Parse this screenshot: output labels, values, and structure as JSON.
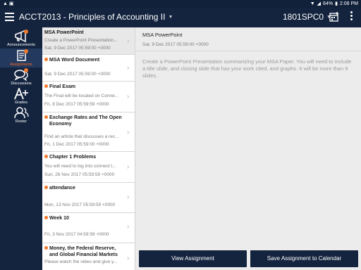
{
  "status_bar": {
    "left_icons": [
      "notification-icon",
      "image-icon"
    ],
    "battery": "64%",
    "time": "2:08 PM"
  },
  "app_bar": {
    "course_title": "ACCT2013 - Principles of Accounting II",
    "section": "1801SPC0"
  },
  "left_nav": {
    "items": [
      {
        "label": "Announcements",
        "icon": "megaphone-icon",
        "active": false,
        "badge": true
      },
      {
        "label": "Assignments",
        "icon": "assignments-icon",
        "active": true,
        "badge": true
      },
      {
        "label": "Discussions",
        "icon": "discussions-icon",
        "active": false,
        "badge": true
      },
      {
        "label": "Grades",
        "icon": "grades-icon",
        "active": false,
        "badge": false
      },
      {
        "label": "Roster",
        "icon": "roster-icon",
        "active": false,
        "badge": false
      }
    ]
  },
  "assignment_list": [
    {
      "title": "MSA PowerPoint",
      "preview": "Create a PowerPoint Presentation...",
      "date": "Sat, 9 Dec 2017 05:59:00 +0000",
      "unread": false,
      "selected": true
    },
    {
      "title": "MSA Word Document",
      "preview": "",
      "date": "Sat, 9 Dec 2017 05:59:00 +0000",
      "unread": true,
      "selected": false
    },
    {
      "title": "Final Exam",
      "preview": "The Final will be located on Conne...",
      "date": "Fri, 8 Dec 2017 05:59:59 +0000",
      "unread": true,
      "selected": false
    },
    {
      "title": "Exchange Rates and The Open Economy",
      "preview": "Find an article that discusses a rec...",
      "date": "Fri, 1 Dec 2017 05:59:00 +0000",
      "unread": true,
      "selected": false
    },
    {
      "title": "Chapter 1 Problems",
      "preview": "You will need to log into connect t...",
      "date": "Sun, 26 Nov 2017 05:59:59 +0000",
      "unread": true,
      "selected": false
    },
    {
      "title": "attendance",
      "preview": "",
      "date": "Mon, 13 Nov 2017 05:59:59 +0000",
      "unread": true,
      "selected": false
    },
    {
      "title": "Week 10",
      "preview": "",
      "date": "Fri, 3 Nov 2017 04:59:59 +0000",
      "unread": true,
      "selected": false
    },
    {
      "title": "Money, the Federal Reserve, and Global Financial Markets",
      "preview": "Please watch the video and give y...",
      "date": "",
      "unread": true,
      "selected": false
    }
  ],
  "detail": {
    "title": "MSA PowerPoint",
    "date": "Sat, 9 Dec 2017 05:59:00 +0000",
    "description": "Create a PowerPoint Presentation summarizing your MSA Paper. You will need to include a title slide, and closing slide that has your work cited, and graphs. It will be more than 9 slides.",
    "view_button": "View Assignment",
    "save_button": "Save Assignment to Calendar"
  },
  "colors": {
    "nav_bg": "#14243f",
    "accent_orange": "#f07a2a",
    "active_label": "#ff6a1f",
    "button_bg": "#14243f"
  }
}
